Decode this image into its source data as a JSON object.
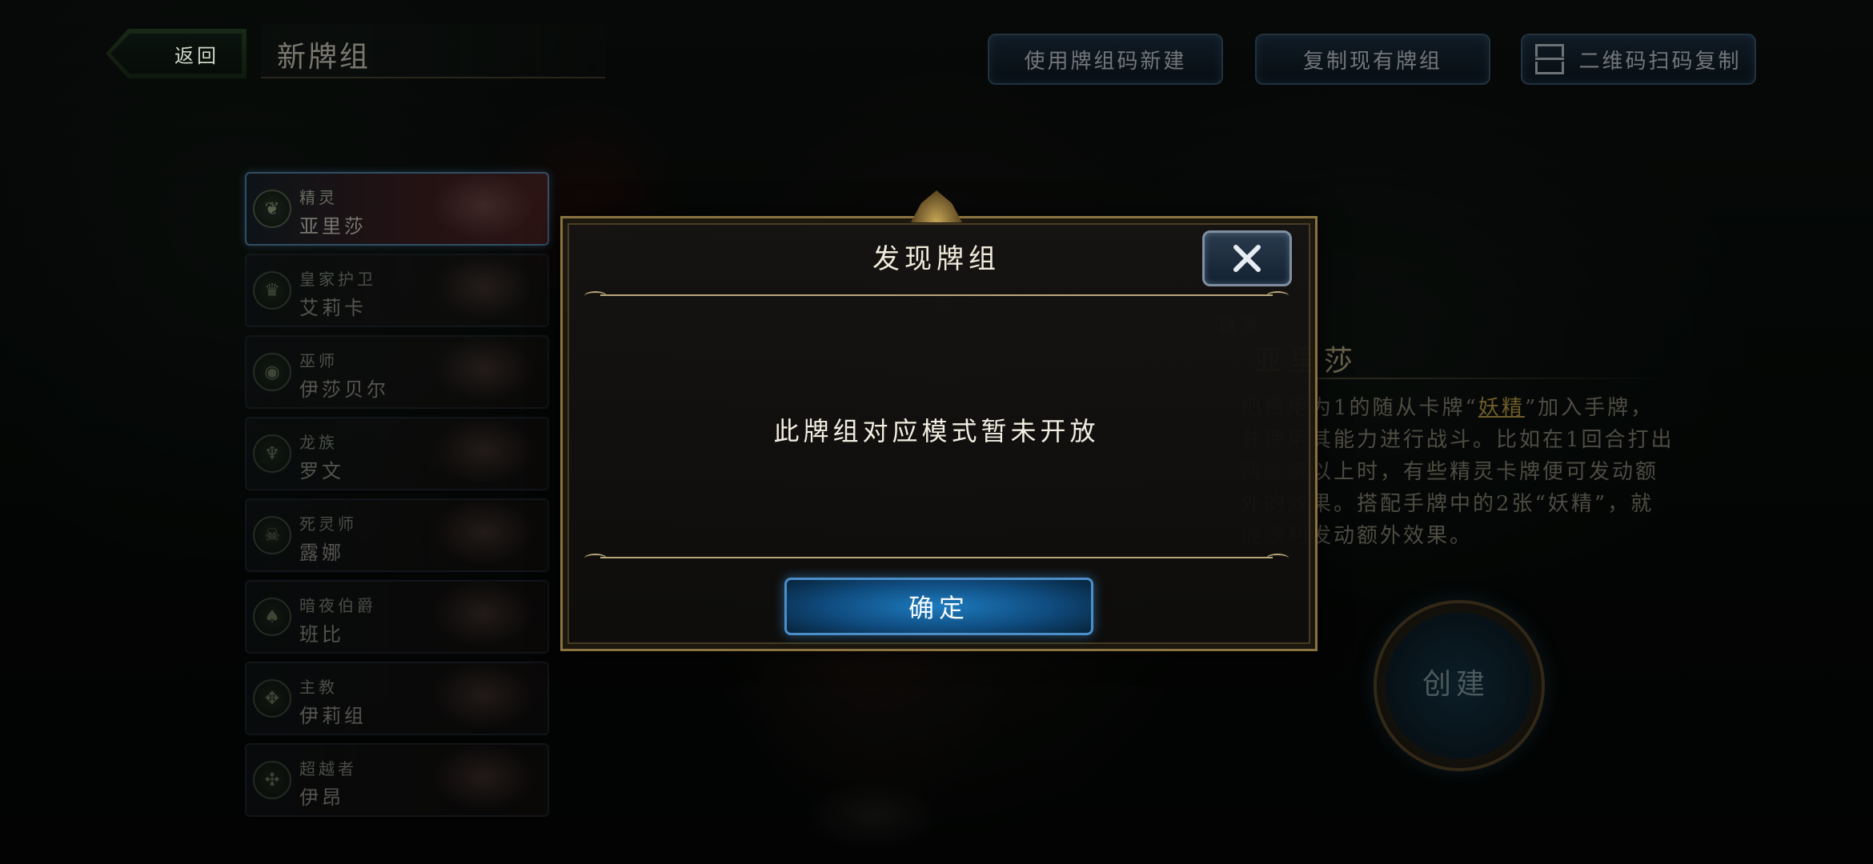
{
  "header": {
    "back_label": "返回",
    "page_title": "新牌组",
    "buttons": {
      "new_from_code": "使用牌组码新建",
      "copy_existing": "复制现有牌组",
      "qr_copy": "二维码扫码复制"
    }
  },
  "class_list": [
    {
      "type": "精灵",
      "name": "亚里莎",
      "icon": "leaf-icon",
      "active": true
    },
    {
      "type": "皇家护卫",
      "name": "艾莉卡",
      "icon": "crown-icon",
      "active": false
    },
    {
      "type": "巫师",
      "name": "伊莎贝尔",
      "icon": "eye-icon",
      "active": false
    },
    {
      "type": "龙族",
      "name": "罗文",
      "icon": "claw-icon",
      "active": false
    },
    {
      "type": "死灵师",
      "name": "露娜",
      "icon": "skull-icon",
      "active": false
    },
    {
      "type": "暗夜伯爵",
      "name": "班比",
      "icon": "bat-icon",
      "active": false
    },
    {
      "type": "主教",
      "name": "伊莉组",
      "icon": "wing-icon",
      "active": false
    },
    {
      "type": "超越者",
      "name": "伊昂",
      "icon": "rune-icon",
      "active": false
    }
  ],
  "info_panel": {
    "type": "精灵",
    "name": "亚里莎",
    "desc_before": "把费用为1的随从卡牌“",
    "desc_highlight": "妖精",
    "desc_after": "”加入手牌，并使用其能力进行战斗。比如在1回合打出两张牌以上时，有些精灵卡牌便可发动额外的效果。搭配手牌中的2张“妖精”，就能顺利发动额外效果。"
  },
  "create_button": "创建",
  "modal": {
    "title": "发现牌组",
    "message": "此牌组对应模式暂未开放",
    "confirm": "确定"
  },
  "colors": {
    "modal_border": "#8a7340",
    "confirm_blue": "#1d7bbf",
    "active_border": "#5a8fb4",
    "highlight_gold": "#c9a94e"
  }
}
